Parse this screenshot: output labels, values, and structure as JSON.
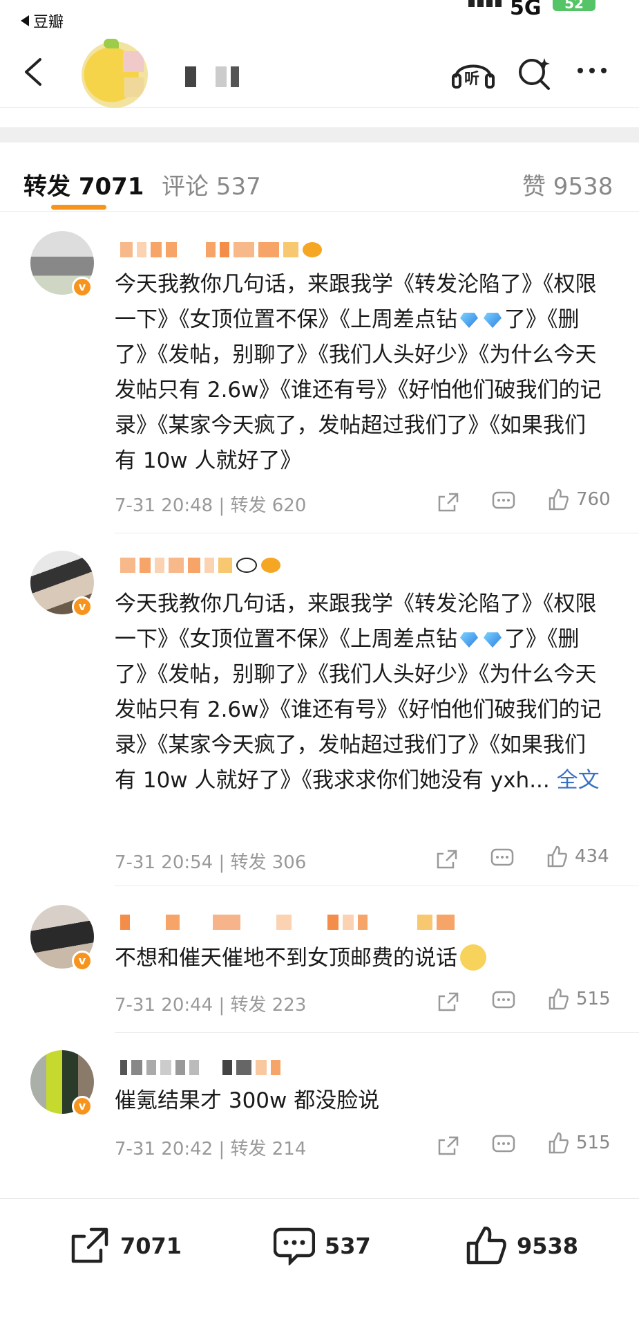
{
  "status_bar": {
    "back_app": "豆瓣",
    "network": "5G",
    "battery": "52"
  },
  "header": {
    "listen_label": "听"
  },
  "tabs": {
    "repost": "转发 7071",
    "comment": "评论 537",
    "like": "赞 9538"
  },
  "posts": [
    {
      "text": "今天我教你几句话，来跟我学《转发沦陷了》《权限一下》《女顶位置不保》《上周差点钻",
      "text2": "了》《删了》《发帖，别聊了》《我们人头好少》《为什么今天发帖只有 2.6w》《谁还有号》《好怕他们破我们的记录》《某家今天疯了，发帖超过我们了》《如果我们有 10w 人就好了》",
      "meta": "7-31 20:48 | 转发 620",
      "likes": "760"
    },
    {
      "text": "今天我教你几句话，来跟我学《转发沦陷了》《权限一下》《女顶位置不保》《上周差点钻",
      "text2": "了》《删了》《发帖，别聊了》《我们人头好少》《为什么今天发帖只有 2.6w》《谁还有号》《好怕他们破我们的记录》《某家今天疯了，发帖超过我们了》《如果我们有 10w 人就好了》《我求求你们她没有 yxh...",
      "more": "全文",
      "meta": "7-31 20:54 | 转发 306",
      "likes": "434"
    },
    {
      "text": "不想和催天催地不到女顶邮费的说话",
      "meta": "7-31 20:44 | 转发 223",
      "likes": "515"
    },
    {
      "text": "催氪结果才 300w 都没脸说",
      "meta": "7-31 20:42 | 转发 214",
      "likes": "515"
    }
  ],
  "bottom_bar": {
    "repost": "7071",
    "comment": "537",
    "like": "9538"
  },
  "colors": {
    "accent": "#f7941d",
    "link": "#3870c4"
  },
  "icons": [
    "back-arrow-icon",
    "listen-icon",
    "search-icon",
    "more-icon",
    "share-icon",
    "comment-icon",
    "like-icon",
    "verified-icon"
  ]
}
